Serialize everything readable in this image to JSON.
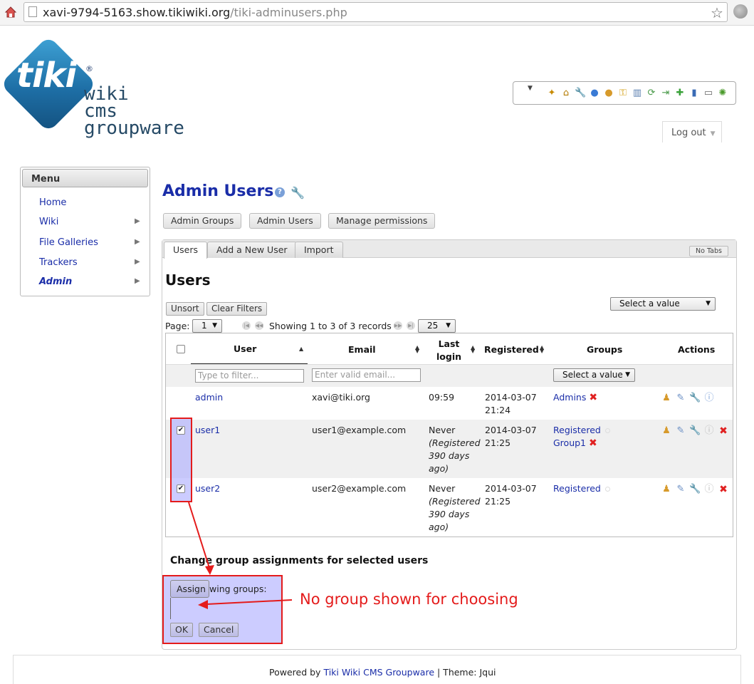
{
  "browser": {
    "url_host": "xavi-9794-5163.show.tikiwiki.org",
    "url_path": "/tiki-adminusers.php"
  },
  "logo": {
    "mark": "tiki",
    "reg": "®",
    "line1": "wiki",
    "line2": "cms",
    "line3": "groupware"
  },
  "header": {
    "logout_label": "Log out"
  },
  "menu": {
    "title": "Menu",
    "items": [
      {
        "label": "Home"
      },
      {
        "label": "Wiki"
      },
      {
        "label": "File Galleries"
      },
      {
        "label": "Trackers"
      },
      {
        "label": "Admin"
      }
    ]
  },
  "page": {
    "title": "Admin Users",
    "buttons": {
      "admin_groups": "Admin Groups",
      "admin_users": "Admin Users",
      "manage_permissions": "Manage permissions"
    },
    "tabs": [
      {
        "label": "Users"
      },
      {
        "label": "Add a New User"
      },
      {
        "label": "Import"
      }
    ],
    "no_tabs": "No Tabs",
    "section_title": "Users",
    "action_select": "Select a value",
    "unsort": "Unsort",
    "clear_filters": "Clear Filters",
    "page_label": "Page:",
    "page_value": "1",
    "showing": "Showing 1 to 3 of 3 records",
    "per_page": "25"
  },
  "table": {
    "headers": {
      "user": "User",
      "email": "Email",
      "last_login_1": "Last",
      "last_login_2": "login",
      "registered": "Registered",
      "groups": "Groups",
      "actions": "Actions"
    },
    "filters": {
      "user_placeholder": "Type to filter...",
      "email_placeholder": "Enter valid email...",
      "groups_select": "Select a value"
    },
    "rows": [
      {
        "user": "admin",
        "email": "xavi@tiki.org",
        "last_login": "09:59",
        "last_login_note": "",
        "registered_date": "2014-03-07",
        "registered_time": "21:24",
        "group1": "Admins",
        "group2": ""
      },
      {
        "user": "user1",
        "email": "user1@example.com",
        "last_login": "Never",
        "last_login_note": "(Registered 390 days ago)",
        "registered_date": "2014-03-07",
        "registered_time": "21:25",
        "group1": "Registered",
        "group2": "Group1"
      },
      {
        "user": "user2",
        "email": "user2@example.com",
        "last_login": "Never",
        "last_login_note": "(Registered 390 days ago)",
        "registered_date": "2014-03-07",
        "registered_time": "21:25",
        "group1": "Registered",
        "group2": ""
      }
    ]
  },
  "group_assign": {
    "title": "Change group assignments for selected users",
    "assign_btn": "Assign",
    "assign_label_tail": "wing groups:",
    "ok": "OK",
    "cancel": "Cancel"
  },
  "annotation": {
    "note": "No group shown for choosing",
    "color": "#e41b1b"
  },
  "footer": {
    "powered_by": "Powered by",
    "link": "Tiki Wiki CMS Groupware",
    "theme": "| Theme: Jqui"
  }
}
